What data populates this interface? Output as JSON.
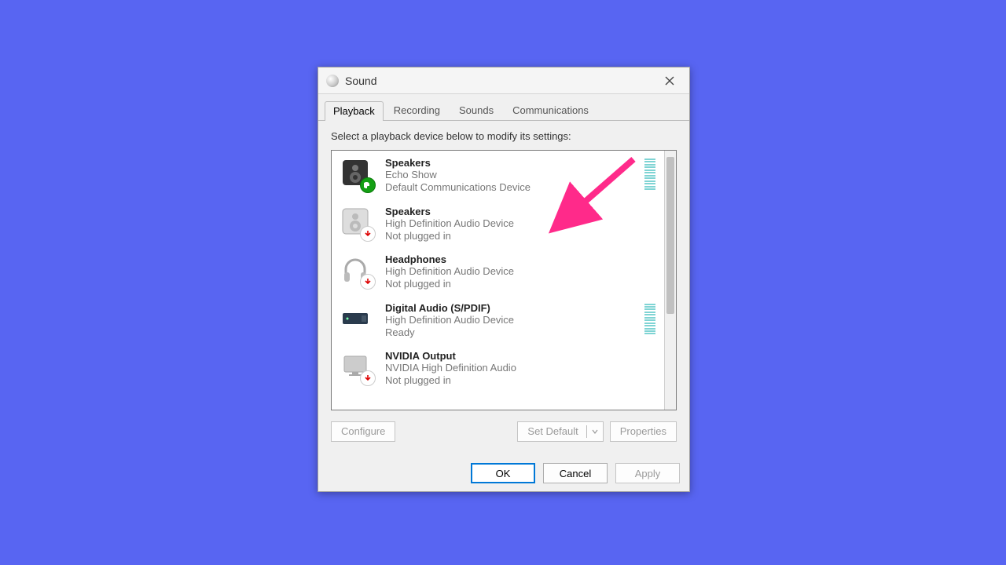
{
  "title": "Sound",
  "tabs": {
    "t0": "Playback",
    "t1": "Recording",
    "t2": "Sounds",
    "t3": "Communications"
  },
  "instruction": "Select a playback device below to modify its settings:",
  "devices": [
    {
      "name": "Speakers",
      "sub1": "Echo Show",
      "sub2": "Default Communications Device",
      "badge": "ok",
      "meter": true,
      "icon": "speaker-dark"
    },
    {
      "name": "Speakers",
      "sub1": "High Definition Audio Device",
      "sub2": "Not plugged in",
      "badge": "unplug",
      "meter": false,
      "icon": "speaker-light"
    },
    {
      "name": "Headphones",
      "sub1": "High Definition Audio Device",
      "sub2": "Not plugged in",
      "badge": "unplug",
      "meter": false,
      "icon": "headphones"
    },
    {
      "name": "Digital Audio (S/PDIF)",
      "sub1": "High Definition Audio Device",
      "sub2": "Ready",
      "badge": "none",
      "meter": true,
      "icon": "spdif"
    },
    {
      "name": "NVIDIA Output",
      "sub1": "NVIDIA High Definition Audio",
      "sub2": "Not plugged in",
      "badge": "unplug",
      "meter": false,
      "icon": "monitor"
    }
  ],
  "buttons": {
    "configure": "Configure",
    "setdefault": "Set Default",
    "properties": "Properties",
    "ok": "OK",
    "cancel": "Cancel",
    "apply": "Apply"
  }
}
